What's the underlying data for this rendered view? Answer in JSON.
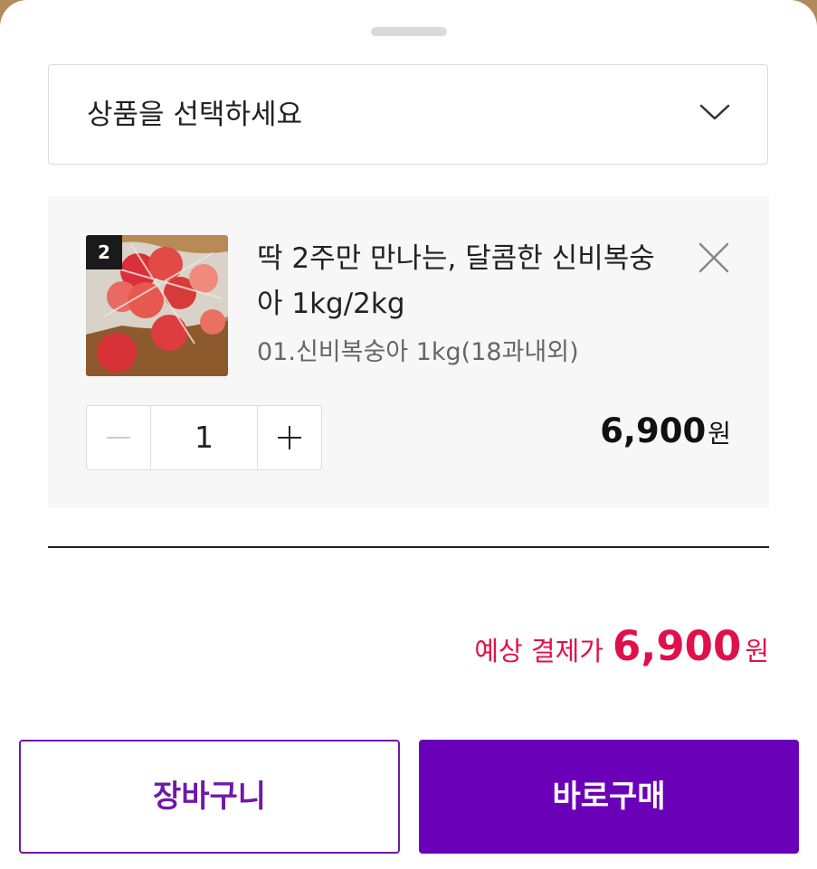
{
  "option_select": {
    "placeholder": "상품을 선택하세요",
    "icon": "chevron-down-icon"
  },
  "selected_item": {
    "badge": "2",
    "title": "딱 2주만 만나는, 달콤한 신비복숭아 1kg/2kg",
    "option": "01.신비복숭아 1kg(18과내외)",
    "quantity": "1",
    "price": "6,900",
    "price_unit": "원",
    "remove_icon": "close-icon",
    "decrease_icon": "minus-icon",
    "increase_icon": "plus-icon"
  },
  "summary": {
    "label": "예상 결제가",
    "total": "6,900",
    "unit": "원"
  },
  "actions": {
    "cart_label": "장바구니",
    "buy_label": "바로구매"
  },
  "colors": {
    "accent": "#6a00b8",
    "price_highlight": "#e0114a"
  }
}
